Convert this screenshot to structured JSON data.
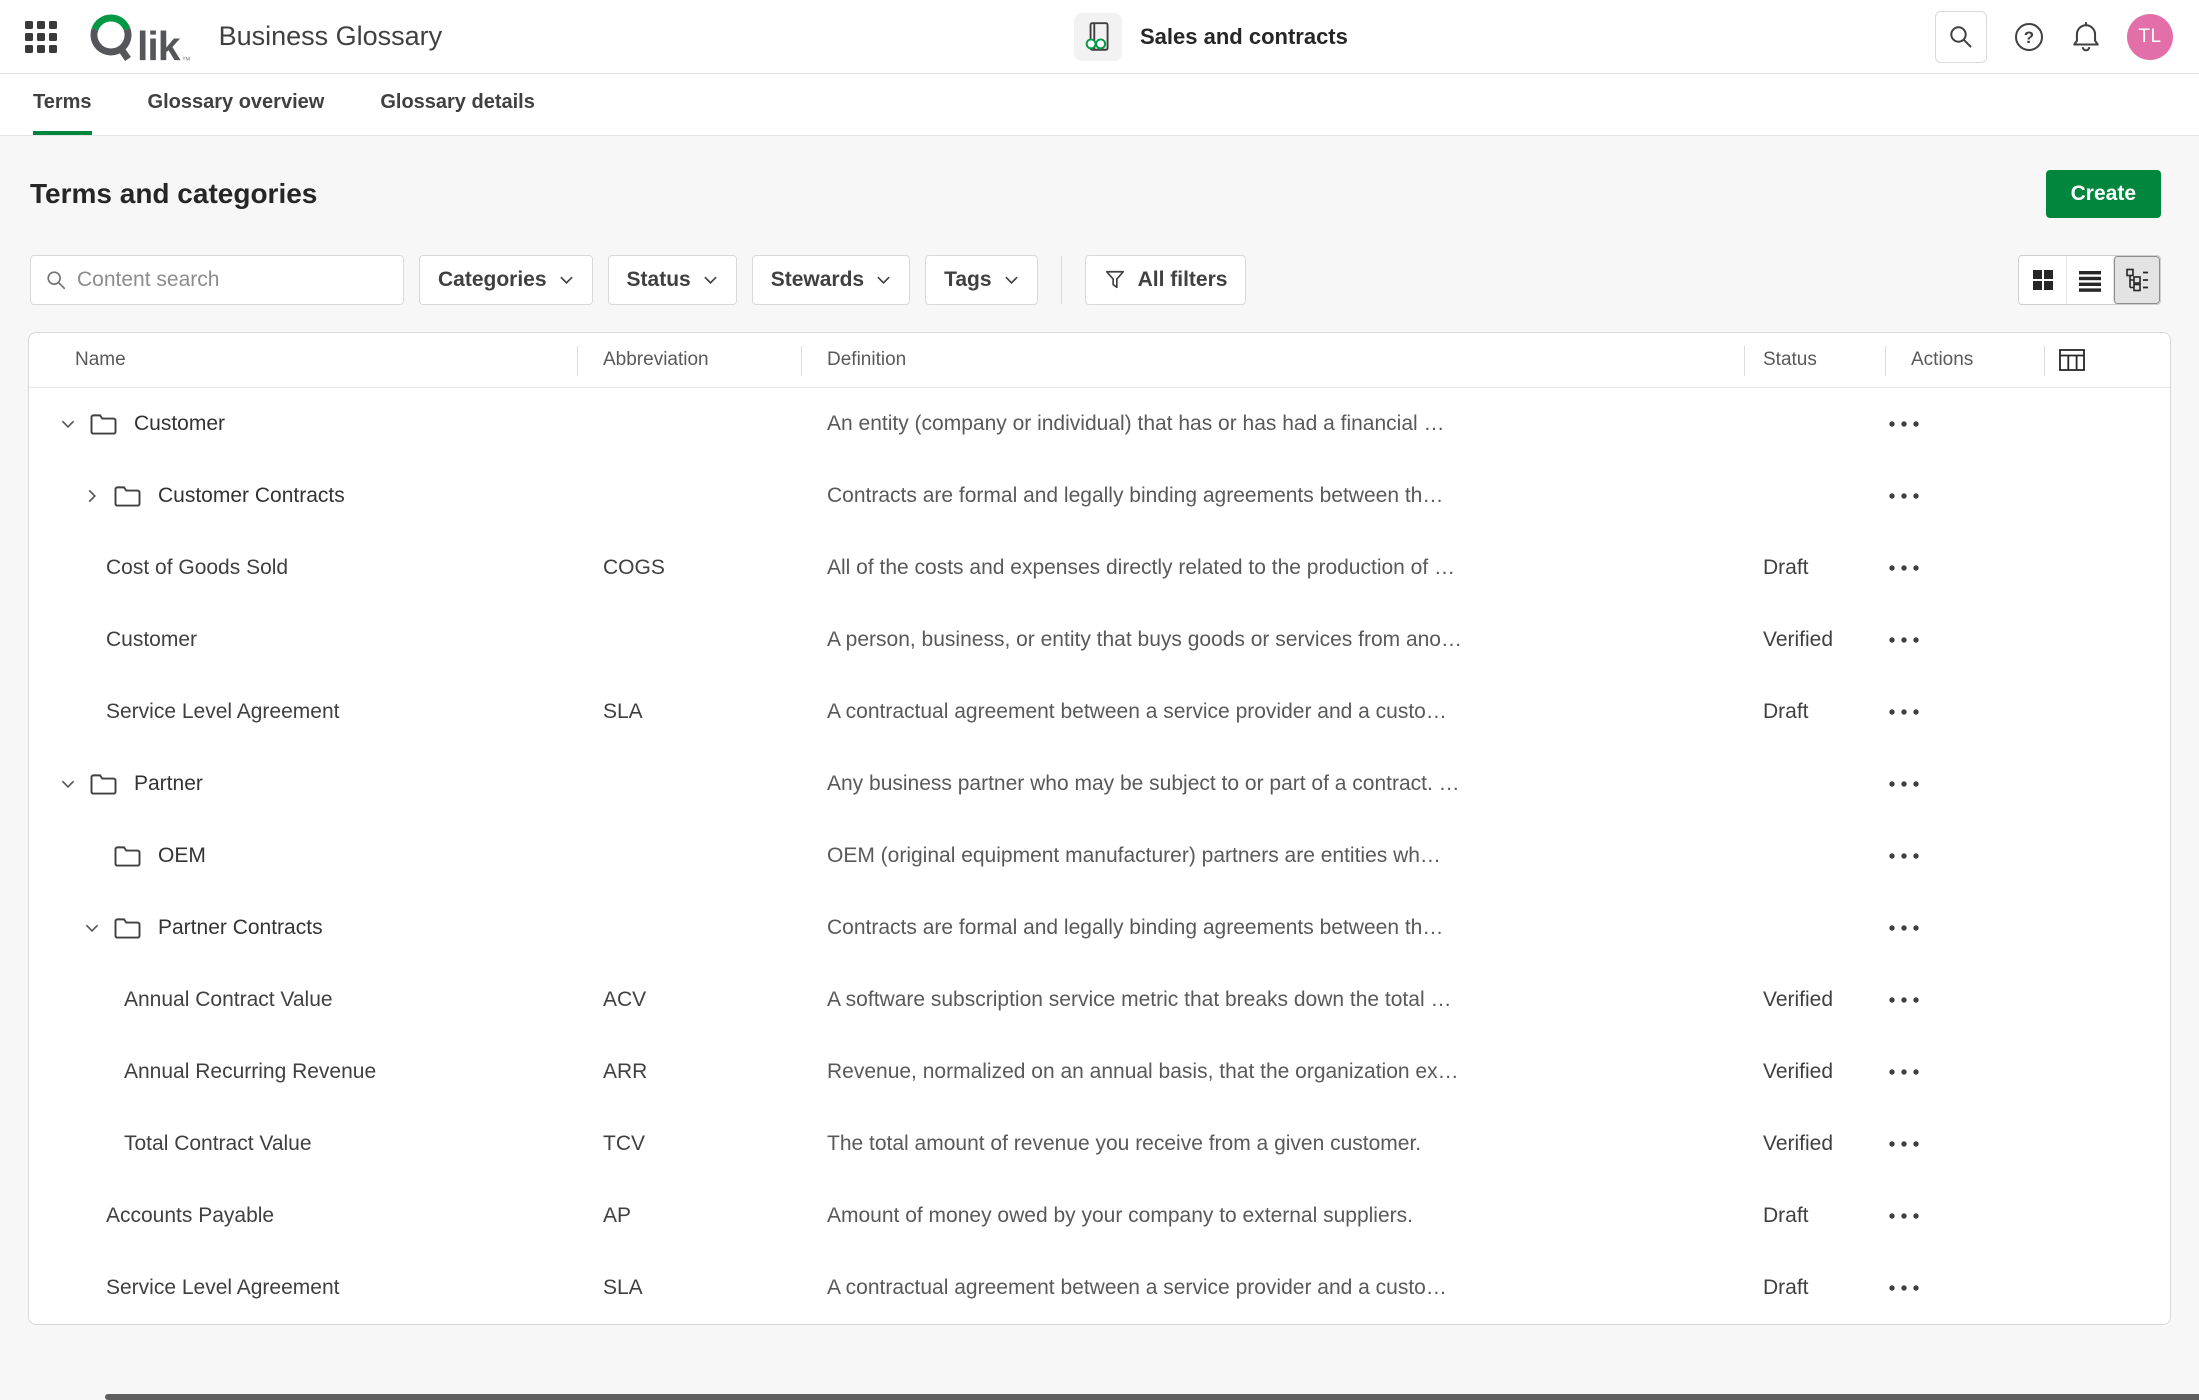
{
  "header": {
    "logo_text": "lik",
    "app_title": "Business Glossary",
    "glossary_name": "Sales and contracts",
    "avatar_initials": "TL"
  },
  "tabs": [
    {
      "label": "Terms",
      "active": true
    },
    {
      "label": "Glossary overview",
      "active": false
    },
    {
      "label": "Glossary details",
      "active": false
    }
  ],
  "page": {
    "title": "Terms and categories",
    "create_label": "Create"
  },
  "toolbar": {
    "search_placeholder": "Content search",
    "filters": [
      "Categories",
      "Status",
      "Stewards",
      "Tags"
    ],
    "all_filters_label": "All filters"
  },
  "table": {
    "columns": {
      "name": "Name",
      "abbreviation": "Abbreviation",
      "definition": "Definition",
      "status": "Status",
      "actions": "Actions"
    },
    "rows": [
      {
        "type": "category",
        "level": 0,
        "chevron": "down",
        "name": "Customer",
        "abbreviation": "",
        "definition": "An entity (company or individual) that has or has had a financial …",
        "status": ""
      },
      {
        "type": "category",
        "level": 1,
        "chevron": "right",
        "name": "Customer Contracts",
        "abbreviation": "",
        "definition": "Contracts are formal and legally binding agreements between th…",
        "status": ""
      },
      {
        "type": "term",
        "level": 1,
        "chevron": "",
        "name": "Cost of Goods Sold",
        "abbreviation": "COGS",
        "definition": "All of the costs and expenses directly related to the production of …",
        "status": "Draft"
      },
      {
        "type": "term",
        "level": 1,
        "chevron": "",
        "name": "Customer",
        "abbreviation": "",
        "definition": "A person, business, or entity that buys goods or services from ano…",
        "status": "Verified"
      },
      {
        "type": "term",
        "level": 1,
        "chevron": "",
        "name": "Service Level Agreement",
        "abbreviation": "SLA",
        "definition": "A contractual agreement between a service provider and a custo…",
        "status": "Draft"
      },
      {
        "type": "category",
        "level": 0,
        "chevron": "down",
        "name": "Partner",
        "abbreviation": "",
        "definition": "Any business partner who may be subject to or part of a contract. …",
        "status": ""
      },
      {
        "type": "category",
        "level": 1,
        "chevron": "none",
        "name": "OEM",
        "abbreviation": "",
        "definition": "OEM (original equipment manufacturer) partners are entities wh…",
        "status": ""
      },
      {
        "type": "category",
        "level": 1,
        "chevron": "down",
        "name": "Partner Contracts",
        "abbreviation": "",
        "definition": "Contracts are formal and legally binding agreements between th…",
        "status": ""
      },
      {
        "type": "term",
        "level": 2,
        "chevron": "",
        "name": "Annual Contract Value",
        "abbreviation": "ACV",
        "definition": "A software subscription service metric that breaks down the total …",
        "status": "Verified"
      },
      {
        "type": "term",
        "level": 2,
        "chevron": "",
        "name": "Annual Recurring Revenue",
        "abbreviation": "ARR",
        "definition": "Revenue, normalized on an annual basis, that the organization ex…",
        "status": "Verified"
      },
      {
        "type": "term",
        "level": 2,
        "chevron": "",
        "name": "Total Contract Value",
        "abbreviation": "TCV",
        "definition": "The total amount of revenue you receive from a given customer.",
        "status": "Verified"
      },
      {
        "type": "term",
        "level": 1,
        "chevron": "",
        "name": "Accounts Payable",
        "abbreviation": "AP",
        "definition": "Amount of money owed by your company to external suppliers.",
        "status": "Draft"
      },
      {
        "type": "term",
        "level": 1,
        "chevron": "",
        "name": "Service Level Agreement",
        "abbreviation": "SLA",
        "definition": "A contractual agreement between a service provider and a custo…",
        "status": "Draft"
      }
    ]
  },
  "colors": {
    "create_button_green": "#00873d",
    "qlik_green": "#009845",
    "avatar_pink": "#e36fa9"
  }
}
